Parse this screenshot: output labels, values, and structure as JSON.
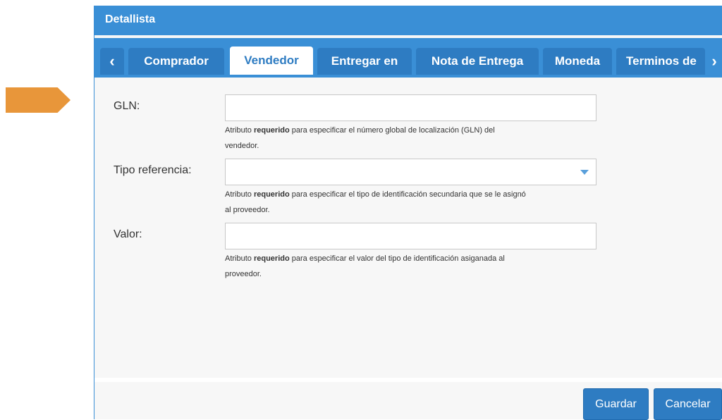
{
  "dialog": {
    "title": "Detallista"
  },
  "tabs": [
    {
      "label": "Comprador",
      "active": false
    },
    {
      "label": "Vendedor",
      "active": true
    },
    {
      "label": "Entregar en",
      "active": false
    },
    {
      "label": "Nota de Entrega",
      "active": false
    },
    {
      "label": "Moneda",
      "active": false
    },
    {
      "label": "Terminos de",
      "active": false
    }
  ],
  "tab_scroll": {
    "left": "‹",
    "right": "›"
  },
  "form": {
    "gln": {
      "label": "GLN:",
      "value": "",
      "help_pre": "Atributo ",
      "help_bold": "requerido",
      "help_post_line1": " para especificar el número global de localización (GLN) del",
      "help_line2": "vendedor."
    },
    "tipo_referencia": {
      "label": "Tipo referencia:",
      "value": "",
      "help_pre": "Atributo ",
      "help_bold": "requerido",
      "help_post_line1": " para especificar el tipo de identificación secundaria que se le asignó",
      "help_line2": "al proveedor."
    },
    "valor": {
      "label": "Valor:",
      "value": "",
      "help_pre": "Atributo ",
      "help_bold": "requerido",
      "help_post_line1": " para especificar el valor del tipo de identificación asiganada al",
      "help_line2": "proveedor."
    }
  },
  "footer": {
    "save_label": "Guardar",
    "cancel_label": "Cancelar"
  },
  "colors": {
    "accent": "#3a8fd6",
    "tab_bg": "#2e7cc2",
    "marker": "#E8963A"
  }
}
